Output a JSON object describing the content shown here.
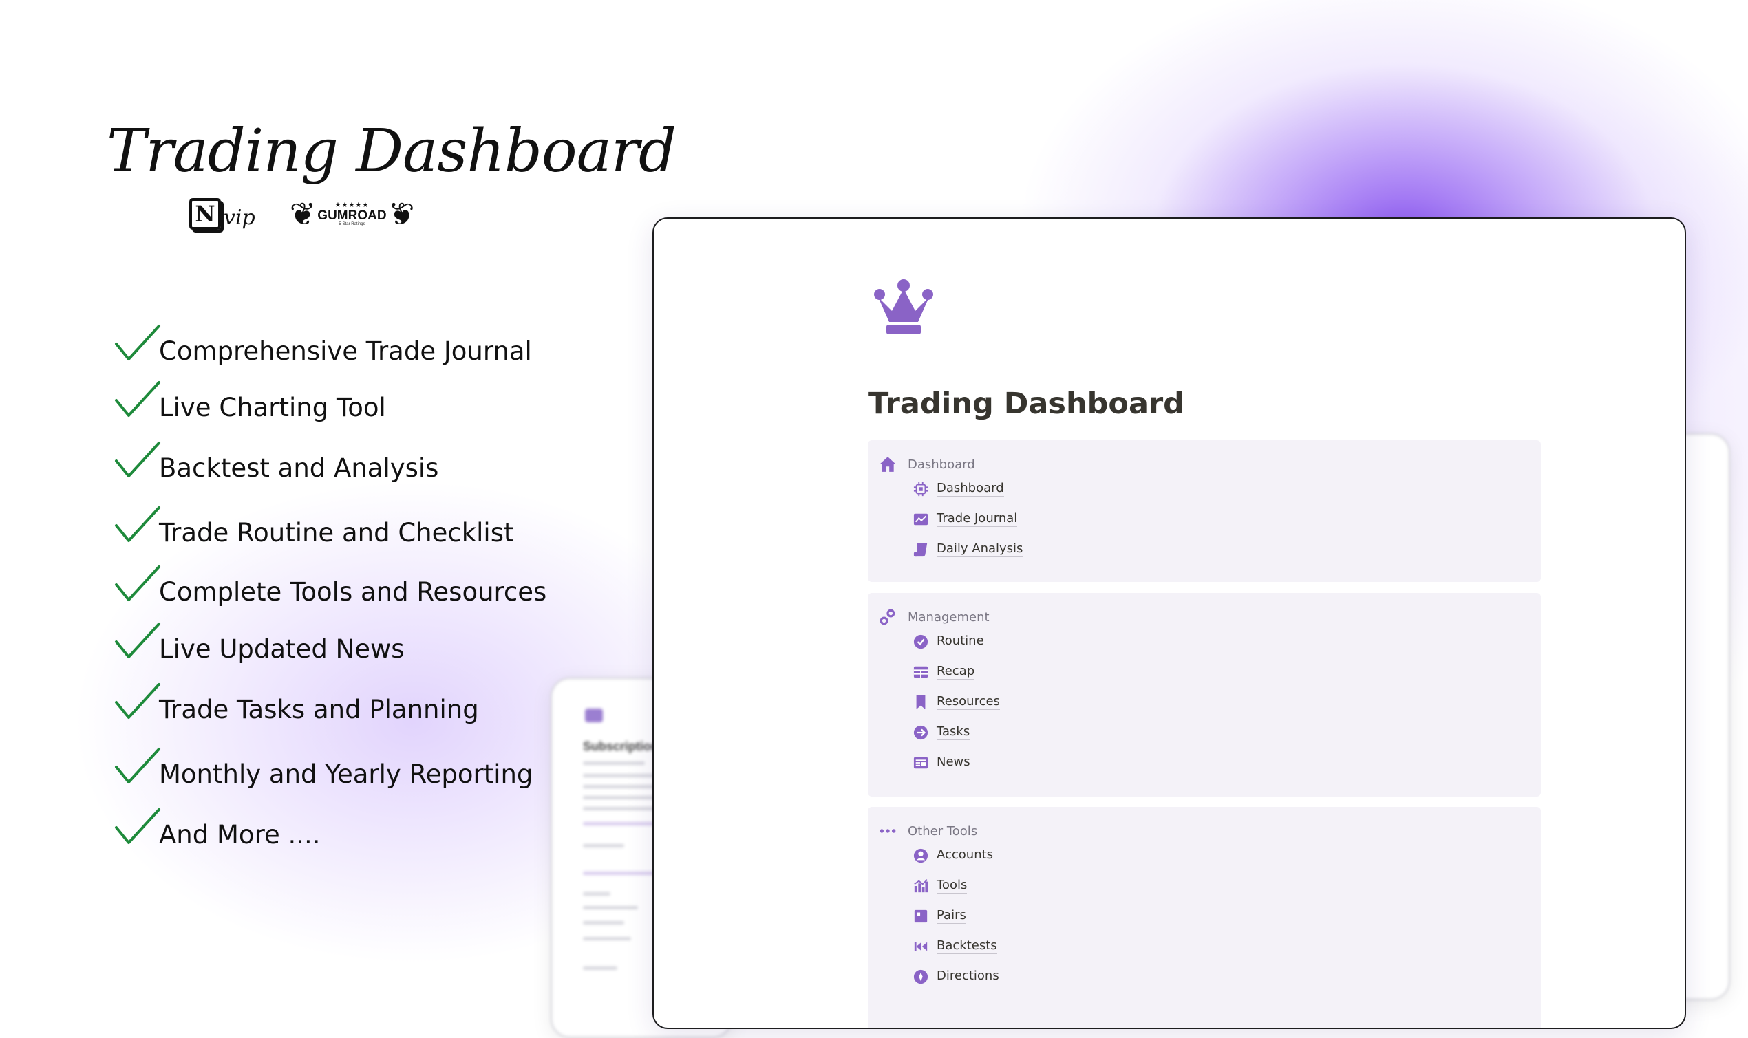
{
  "hero": {
    "title": "Trading Dashboard",
    "notion_badge": {
      "logo": "N",
      "suffix": "vip"
    },
    "gumroad_badge": {
      "stars": "★★★★★",
      "name": "GUMROAD",
      "sub": "5-Star Ratings"
    }
  },
  "features": [
    "Comprehensive Trade Journal",
    "Live Charting Tool",
    "Backtest and Analysis",
    "Trade Routine and Checklist",
    "Complete Tools and Resources",
    "Live Updated News",
    "Trade Tasks and Planning",
    "Monthly and Yearly Reporting",
    "And More ...."
  ],
  "colors": {
    "accent": "#8a63c6",
    "check": "#1e8a3b",
    "glow": "#8954f0"
  },
  "window": {
    "page_icon": "crown-icon",
    "title": "Trading Dashboard",
    "sections": [
      {
        "label": "Dashboard",
        "icon": "home-icon",
        "items": [
          {
            "label": "Dashboard",
            "icon": "chip-icon"
          },
          {
            "label": "Trade Journal",
            "icon": "chart-line-icon"
          },
          {
            "label": "Daily Analysis",
            "icon": "scroll-icon"
          }
        ]
      },
      {
        "label": "Management",
        "icon": "gears-icon",
        "items": [
          {
            "label": "Routine",
            "icon": "check-circle-icon"
          },
          {
            "label": "Recap",
            "icon": "table-icon"
          },
          {
            "label": "Resources",
            "icon": "bookmark-icon"
          },
          {
            "label": "Tasks",
            "icon": "arrow-circle-icon"
          },
          {
            "label": "News",
            "icon": "newspaper-icon"
          }
        ]
      },
      {
        "label": "Other Tools",
        "icon": "dots-icon",
        "items": [
          {
            "label": "Accounts",
            "icon": "user-circle-icon"
          },
          {
            "label": "Tools",
            "icon": "bar-chart-icon"
          },
          {
            "label": "Pairs",
            "icon": "square-icon"
          },
          {
            "label": "Backtests",
            "icon": "rewind-icon"
          },
          {
            "label": "Directions",
            "icon": "compass-icon"
          }
        ]
      }
    ]
  },
  "back_card": {
    "title": "Subscription"
  }
}
